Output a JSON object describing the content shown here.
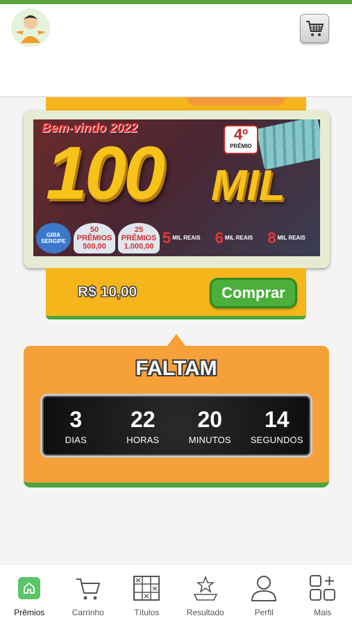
{
  "app": {
    "accent_color": "#5aa43a",
    "logo_icon": "mascot-logo-icon",
    "cart_icon": "cart-icon"
  },
  "product": {
    "banner": {
      "welcome": "Bem-vindo 2022",
      "amount_big": "100",
      "amount_word": "MIL",
      "premio_number": "4º",
      "premio_label": "PRÊMIO",
      "gira_label": "GIRA SERGIPE",
      "wheel1": "50 PRÊMIOS",
      "wheel1_value": "500,00",
      "wheel2": "25 PRÊMIOS",
      "wheel2_value": "1.000,00",
      "prizes": [
        {
          "rank": "5",
          "text": "MIL REAIS"
        },
        {
          "rank": "6",
          "text": "MIL REAIS"
        },
        {
          "rank": "8",
          "text": "MIL REAIS"
        }
      ]
    },
    "price": "R$ 10,00",
    "buy_label": "Comprar"
  },
  "countdown": {
    "title": "FALTAM",
    "units": [
      {
        "value": "3",
        "label": "DIAS"
      },
      {
        "value": "22",
        "label": "HORAS"
      },
      {
        "value": "20",
        "label": "MINUTOS"
      },
      {
        "value": "14",
        "label": "SEGUNDOS"
      }
    ]
  },
  "bottom_nav": {
    "items": [
      {
        "label": "Prêmios",
        "icon": "home-icon",
        "active": true
      },
      {
        "label": "Carrinho",
        "icon": "cart-icon"
      },
      {
        "label": "Títulos",
        "icon": "ticket-grid-icon"
      },
      {
        "label": "Resultado",
        "icon": "trophy-star-icon"
      },
      {
        "label": "Perfil",
        "icon": "user-icon"
      },
      {
        "label": "Mais",
        "icon": "more-grid-icon"
      }
    ]
  }
}
